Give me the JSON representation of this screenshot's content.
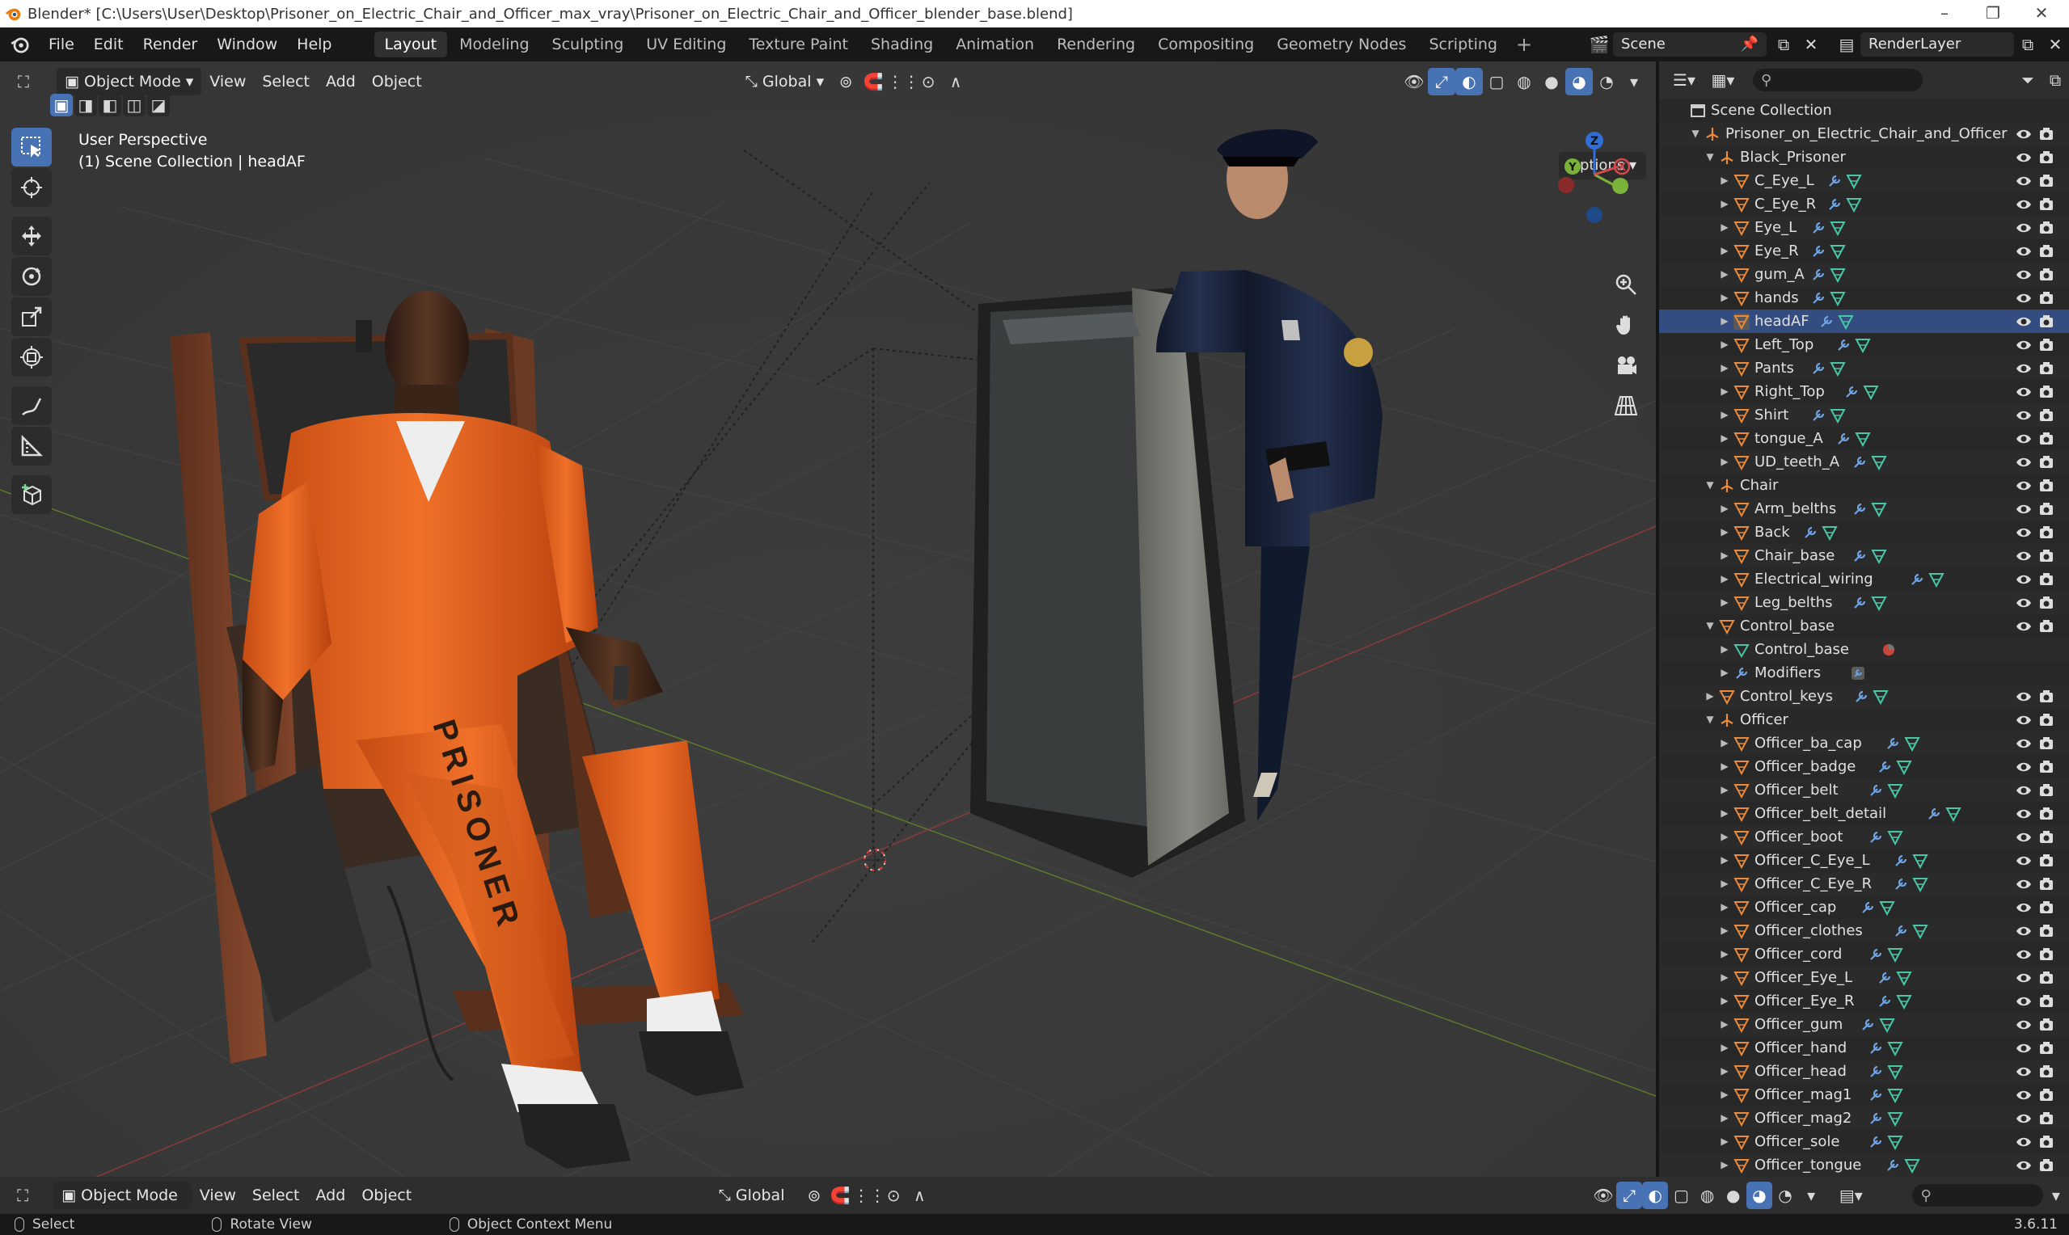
{
  "title": "Blender* [C:\\Users\\User\\Desktop\\Prisoner_on_Electric_Chair_and_Officer_max_vray\\Prisoner_on_Electric_Chair_and_Officer_blender_base.blend]",
  "menu": [
    "File",
    "Edit",
    "Render",
    "Window",
    "Help"
  ],
  "workspaces": [
    "Layout",
    "Modeling",
    "Sculpting",
    "UV Editing",
    "Texture Paint",
    "Shading",
    "Animation",
    "Rendering",
    "Compositing",
    "Geometry Nodes",
    "Scripting"
  ],
  "active_workspace": "Layout",
  "scene": "Scene",
  "render_layer": "RenderLayer",
  "viewport": {
    "mode": "Object Mode",
    "menus": [
      "View",
      "Select",
      "Add",
      "Object"
    ],
    "orientation": "Global",
    "info_line1": "User Perspective",
    "info_line2": "(1) Scene Collection | headAF",
    "options": "Options",
    "gizmo": {
      "z": "Z",
      "y": "Y",
      "x": "X"
    },
    "prisoner_text": "PRISONER"
  },
  "outliner": {
    "rows": [
      {
        "label": "Scene Collection",
        "indent": 0,
        "type": "scene",
        "expand": "",
        "vis": false
      },
      {
        "label": "Prisoner_on_Electric_Chair_and_Officer",
        "indent": 1,
        "type": "empty",
        "expand": "open",
        "vis": true
      },
      {
        "label": "Black_Prisoner",
        "indent": 2,
        "type": "empty",
        "expand": "open",
        "vis": true
      },
      {
        "label": "C_Eye_L",
        "indent": 3,
        "type": "mesh",
        "expand": "closed",
        "vis": true,
        "mods": true
      },
      {
        "label": "C_Eye_R",
        "indent": 3,
        "type": "mesh",
        "expand": "closed",
        "vis": true,
        "mods": true
      },
      {
        "label": "Eye_L",
        "indent": 3,
        "type": "mesh",
        "expand": "closed",
        "vis": true,
        "mods": true
      },
      {
        "label": "Eye_R",
        "indent": 3,
        "type": "mesh",
        "expand": "closed",
        "vis": true,
        "mods": true
      },
      {
        "label": "gum_A",
        "indent": 3,
        "type": "mesh",
        "expand": "closed",
        "vis": true,
        "mods": true
      },
      {
        "label": "hands",
        "indent": 3,
        "type": "mesh",
        "expand": "closed",
        "vis": true,
        "mods": true
      },
      {
        "label": "headAF",
        "indent": 3,
        "type": "mesh",
        "expand": "closed",
        "vis": true,
        "mods": true,
        "active": true
      },
      {
        "label": "Left_Top",
        "indent": 3,
        "type": "mesh",
        "expand": "closed",
        "vis": true,
        "mods": true
      },
      {
        "label": "Pants",
        "indent": 3,
        "type": "mesh",
        "expand": "closed",
        "vis": true,
        "mods": true
      },
      {
        "label": "Right_Top",
        "indent": 3,
        "type": "mesh",
        "expand": "closed",
        "vis": true,
        "mods": true
      },
      {
        "label": "Shirt",
        "indent": 3,
        "type": "mesh",
        "expand": "closed",
        "vis": true,
        "mods": true
      },
      {
        "label": "tongue_A",
        "indent": 3,
        "type": "mesh",
        "expand": "closed",
        "vis": true,
        "mods": true
      },
      {
        "label": "UD_teeth_A",
        "indent": 3,
        "type": "mesh",
        "expand": "closed",
        "vis": true,
        "mods": true
      },
      {
        "label": "Chair",
        "indent": 2,
        "type": "empty",
        "expand": "open",
        "vis": true
      },
      {
        "label": "Arm_belths",
        "indent": 3,
        "type": "mesh",
        "expand": "closed",
        "vis": true,
        "mods": true
      },
      {
        "label": "Back",
        "indent": 3,
        "type": "mesh",
        "expand": "closed",
        "vis": true,
        "mods": true
      },
      {
        "label": "Chair_base",
        "indent": 3,
        "type": "mesh",
        "expand": "closed",
        "vis": true,
        "mods": true
      },
      {
        "label": "Electrical_wiring",
        "indent": 3,
        "type": "mesh",
        "expand": "closed",
        "vis": true,
        "mods": true
      },
      {
        "label": "Leg_belths",
        "indent": 3,
        "type": "mesh",
        "expand": "closed",
        "vis": true,
        "mods": true
      },
      {
        "label": "Control_base",
        "indent": 2,
        "type": "mesh",
        "expand": "open",
        "vis": true
      },
      {
        "label": "Control_base",
        "indent": 3,
        "type": "meshdata",
        "expand": "closed",
        "vis": false,
        "material": true
      },
      {
        "label": "Modifiers",
        "indent": 3,
        "type": "wrench",
        "expand": "closed",
        "vis": false,
        "modbox": true
      },
      {
        "label": "Control_keys",
        "indent": 2,
        "type": "mesh",
        "expand": "closed",
        "vis": true,
        "mods": true
      },
      {
        "label": "Officer",
        "indent": 2,
        "type": "empty",
        "expand": "open",
        "vis": true
      },
      {
        "label": "Officer_ba_cap",
        "indent": 3,
        "type": "mesh",
        "expand": "closed",
        "vis": true,
        "mods": true
      },
      {
        "label": "Officer_badge",
        "indent": 3,
        "type": "mesh",
        "expand": "closed",
        "vis": true,
        "mods": true
      },
      {
        "label": "Officer_belt",
        "indent": 3,
        "type": "mesh",
        "expand": "closed",
        "vis": true,
        "mods": true
      },
      {
        "label": "Officer_belt_detail",
        "indent": 3,
        "type": "mesh",
        "expand": "closed",
        "vis": true,
        "mods": true
      },
      {
        "label": "Officer_boot",
        "indent": 3,
        "type": "mesh",
        "expand": "closed",
        "vis": true,
        "mods": true
      },
      {
        "label": "Officer_C_Eye_L",
        "indent": 3,
        "type": "mesh",
        "expand": "closed",
        "vis": true,
        "mods": true
      },
      {
        "label": "Officer_C_Eye_R",
        "indent": 3,
        "type": "mesh",
        "expand": "closed",
        "vis": true,
        "mods": true
      },
      {
        "label": "Officer_cap",
        "indent": 3,
        "type": "mesh",
        "expand": "closed",
        "vis": true,
        "mods": true
      },
      {
        "label": "Officer_clothes",
        "indent": 3,
        "type": "mesh",
        "expand": "closed",
        "vis": true,
        "mods": true
      },
      {
        "label": "Officer_cord",
        "indent": 3,
        "type": "mesh",
        "expand": "closed",
        "vis": true,
        "mods": true
      },
      {
        "label": "Officer_Eye_L",
        "indent": 3,
        "type": "mesh",
        "expand": "closed",
        "vis": true,
        "mods": true
      },
      {
        "label": "Officer_Eye_R",
        "indent": 3,
        "type": "mesh",
        "expand": "closed",
        "vis": true,
        "mods": true
      },
      {
        "label": "Officer_gum",
        "indent": 3,
        "type": "mesh",
        "expand": "closed",
        "vis": true,
        "mods": true
      },
      {
        "label": "Officer_hand",
        "indent": 3,
        "type": "mesh",
        "expand": "closed",
        "vis": true,
        "mods": true
      },
      {
        "label": "Officer_head",
        "indent": 3,
        "type": "mesh",
        "expand": "closed",
        "vis": true,
        "mods": true
      },
      {
        "label": "Officer_mag1",
        "indent": 3,
        "type": "mesh",
        "expand": "closed",
        "vis": true,
        "mods": true
      },
      {
        "label": "Officer_mag2",
        "indent": 3,
        "type": "mesh",
        "expand": "closed",
        "vis": true,
        "mods": true
      },
      {
        "label": "Officer_sole",
        "indent": 3,
        "type": "mesh",
        "expand": "closed",
        "vis": true,
        "mods": true
      },
      {
        "label": "Officer_tongue",
        "indent": 3,
        "type": "mesh",
        "expand": "closed",
        "vis": true,
        "mods": true
      }
    ]
  },
  "status": {
    "select": "Select",
    "rotate": "Rotate View",
    "context": "Object Context Menu",
    "version": "3.6.11"
  },
  "colors": {
    "accent": "#4772b3",
    "mesh_icon": "#ea8a3a",
    "modifier_icon": "#6fa5e6",
    "meshdata_icon": "#48c6a6",
    "prisoner_orange": "#e8621c",
    "officer_navy": "#1a2440"
  }
}
